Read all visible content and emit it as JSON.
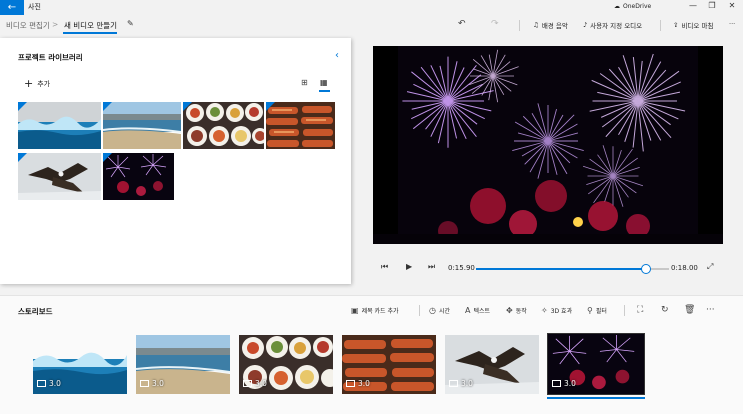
{
  "window": {
    "app_title": "사진",
    "back_icon": "back-arrow-icon",
    "onedrive_label": "OneDrive",
    "minimize": "—",
    "maximize": "❐",
    "close": "✕"
  },
  "command_bar": {
    "breadcrumb_parent": "비디오 편집기",
    "breadcrumb_separator": ">",
    "breadcrumb_current": "새 비디오 만들기",
    "background_music_label": "배경 음악",
    "custom_audio_label": "사용자 지정 오디오",
    "finish_video_label": "비디오 마침",
    "more": "···"
  },
  "library": {
    "title": "프로젝트 라이브러리",
    "add_label": "추가",
    "items": [
      {
        "name": "water-splash"
      },
      {
        "name": "beach"
      },
      {
        "name": "food-plates"
      },
      {
        "name": "grilled-skewers"
      },
      {
        "name": "eagles"
      },
      {
        "name": "fireworks"
      }
    ]
  },
  "player": {
    "current_time": "0:15.90",
    "total_time": "0:18.00",
    "progress": 0.883
  },
  "storyboard": {
    "title": "스토리보드",
    "tools": {
      "title_card": "제목 카드 추가",
      "duration": "시간",
      "text": "텍스트",
      "motion": "동작",
      "effects_3d": "3D 효과",
      "filters": "필터"
    },
    "more": "···",
    "clips": [
      {
        "name": "water-splash",
        "duration": "3.0"
      },
      {
        "name": "beach",
        "duration": "3.0"
      },
      {
        "name": "food-plates",
        "duration": "3.0"
      },
      {
        "name": "grilled-skewers",
        "duration": "3.0"
      },
      {
        "name": "eagles",
        "duration": "3.0"
      },
      {
        "name": "fireworks",
        "duration": "3.0",
        "selected": true
      }
    ]
  },
  "colors": {
    "accent": "#0078d7",
    "panel": "#ffffff",
    "background": "#f2f2f2"
  }
}
